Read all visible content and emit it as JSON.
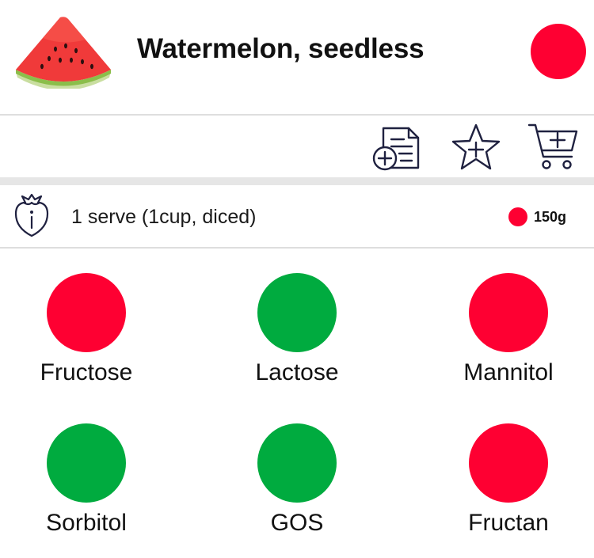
{
  "food": {
    "name": "Watermelon, seedless",
    "image_icon": "watermelon-slice",
    "overall_rating_color": "#fe0032"
  },
  "actions": [
    {
      "icon": "add-to-meal-plan-icon"
    },
    {
      "icon": "add-to-favourites-icon"
    },
    {
      "icon": "add-to-shopping-list-icon"
    }
  ],
  "serving": {
    "icon": "strawberry-info-icon",
    "label": "1 serve (1cup, diced)",
    "rating_color": "#fe0032",
    "weight": "150g"
  },
  "nutrients": [
    {
      "name": "Fructose",
      "color": "#fe0032"
    },
    {
      "name": "Lactose",
      "color": "#00ab3f"
    },
    {
      "name": "Mannitol",
      "color": "#fe0032"
    },
    {
      "name": "Sorbitol",
      "color": "#00ab3f"
    },
    {
      "name": "GOS",
      "color": "#00ab3f"
    },
    {
      "name": "Fructan",
      "color": "#fe0032"
    }
  ]
}
